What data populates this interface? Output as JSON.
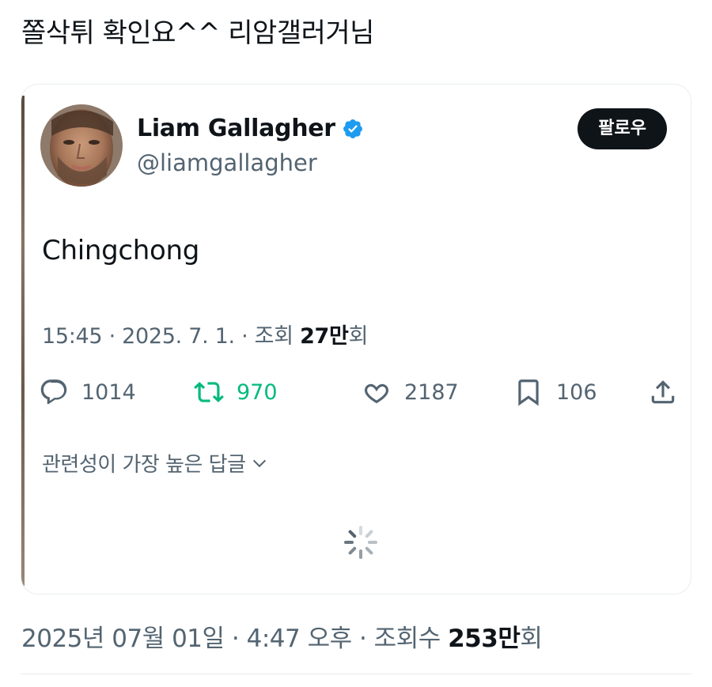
{
  "post": {
    "title": "쫄삭튀 확인요^^ 리암갤러거님"
  },
  "tweet": {
    "author_name": "Liam Gallagher",
    "handle": "@liamgallagher",
    "follow_label": "팔로우",
    "text": "Chingchong",
    "meta_prefix": "15:45 · 2025. 7. 1. · 조회 ",
    "views_count": "27만",
    "views_suffix": "회",
    "replies_count": "1014",
    "retweets_count": "970",
    "likes_count": "2187",
    "bookmarks_count": "106",
    "replies_sort_label": "관련성이 가장 높은 답글",
    "colors": {
      "verified": "#1d9bf0",
      "retweet": "#00ba7c",
      "muted": "#536471",
      "ink": "#0f1419"
    }
  },
  "footer": {
    "meta_prefix": "2025년 07월 01일 · 4:47 오후 · 조회수 ",
    "views_count": "253만",
    "views_suffix": "회"
  },
  "icons": {
    "reply": "speech-bubble-icon",
    "retweet": "retweet-arrows-icon",
    "like": "heart-icon",
    "bookmark": "bookmark-icon",
    "share": "share-upload-icon",
    "verified": "verified-badge-icon",
    "sort": "chevron-down-icon",
    "loading": "loading-spinner-icon"
  }
}
